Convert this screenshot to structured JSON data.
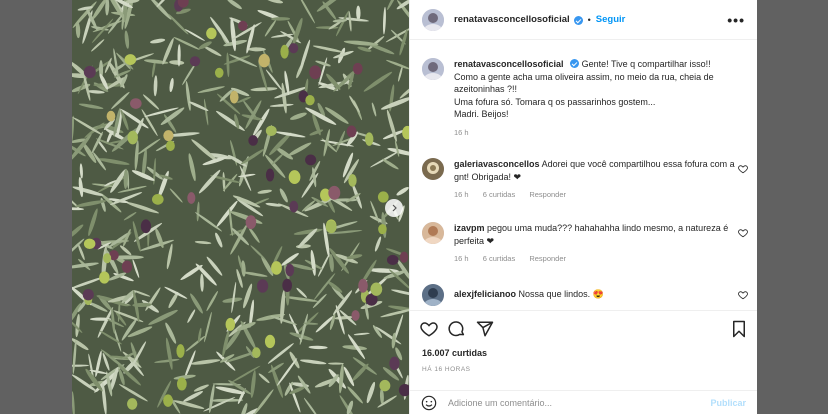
{
  "post": {
    "username": "renatavasconcellosoficial",
    "follow_label": "Seguir",
    "separator": "•",
    "caption_lines": [
      "Gente! Tive q compartilhar isso!!",
      "Como a gente acha uma oliveira assim, no meio da rua, cheia de azeitoninhas ?!!",
      "Uma fofura só. Tomara q os passarinhos gostem...",
      "Madri. Beijos!"
    ],
    "caption_time": "16 h",
    "likes": "16.007 curtidas",
    "posted_ago": "HÁ 16 HORAS"
  },
  "comments": [
    {
      "username": "galeriavasconcellos",
      "text": "Adorei que você compartilhou essa fofura com a gnt! Obrigada! ❤",
      "time": "16 h",
      "likes": "6 curtidas",
      "reply": "Responder"
    },
    {
      "username": "izavpm",
      "text": "pegou uma muda??? hahahahha lindo mesmo, a natureza é perfeita ❤",
      "time": "16 h",
      "likes": "6 curtidas",
      "reply": "Responder"
    },
    {
      "username": "alexjfelicianoo",
      "text": "Nossa que lindos. 😍"
    }
  ],
  "add_comment": {
    "placeholder": "Adicione um comentário...",
    "publish_label": "Publicar"
  },
  "colors": {
    "accent": "#0095f6",
    "verified": "#3897f0",
    "heart": "#ed4956",
    "muted": "#8e8e8e"
  }
}
